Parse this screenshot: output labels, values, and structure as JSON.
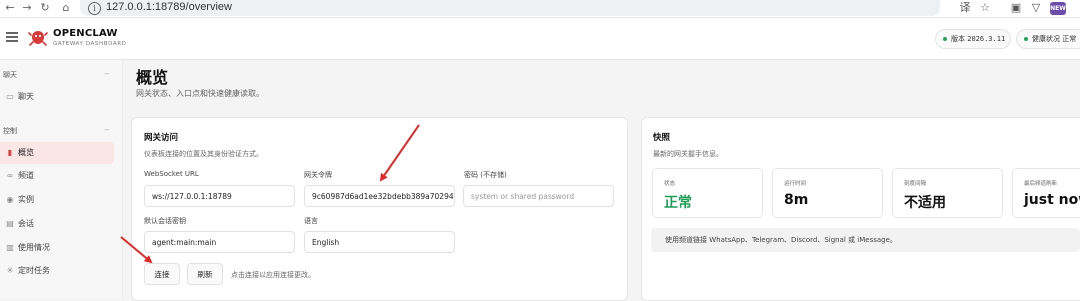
{
  "browser": {
    "back_glyph": "←",
    "forward_glyph": "→",
    "reload_glyph": "↻",
    "home_glyph": "⌂",
    "info_glyph": "i",
    "url": "127.0.0.1:18789/overview",
    "translate_glyph": "译",
    "star_glyph": "☆",
    "extension_glyph": "▣",
    "vpn_glyph": "▽",
    "new_badge": "NEW"
  },
  "header": {
    "brand_title": "OPENCLAW",
    "brand_subtitle": "GATEWAY DASHBOARD",
    "version_label": "版本",
    "version_value": "2026.3.11",
    "health_label": "健康状况",
    "health_value": "正常",
    "status_color": "#22a55a"
  },
  "sidebar": {
    "sections": [
      {
        "label": "聊天",
        "caret": "−",
        "items": [
          {
            "label": "聊天",
            "icon": "chat-icon",
            "glyph": "▭"
          }
        ]
      },
      {
        "label": "控制",
        "caret": "−",
        "items": [
          {
            "label": "概览",
            "icon": "bar-chart-icon",
            "glyph": "▮",
            "active": true
          },
          {
            "label": "频道",
            "icon": "link-icon",
            "glyph": "∞"
          },
          {
            "label": "实例",
            "icon": "radio-icon",
            "glyph": "◉"
          },
          {
            "label": "会话",
            "icon": "file-icon",
            "glyph": "▤"
          },
          {
            "label": "使用情况",
            "icon": "chart-icon",
            "glyph": "▥"
          },
          {
            "label": "定时任务",
            "icon": "loader-icon",
            "glyph": "✳"
          }
        ]
      }
    ],
    "accent_color": "#d64545"
  },
  "main": {
    "title": "概览",
    "subtitle": "网关状态、入口点和快速健康读取。",
    "gateway_card": {
      "title": "网关访问",
      "subtitle": "仪表板连接的位置及其身份验证方式。",
      "ws_label": "WebSocket URL",
      "ws_value": "ws://127.0.0.1:18789",
      "token_label": "网关令牌",
      "token_value": "9c60987d6ad1ee32bdebb389a70294",
      "password_label": "密码 (不存储)",
      "password_placeholder": "system or shared password",
      "session_label": "默认会话密钥",
      "session_value": "agent:main:main",
      "language_label": "语言",
      "language_value": "English",
      "connect_label": "连接",
      "refresh_label": "刷新",
      "hint": "点击连接以应用连接更改。"
    },
    "snapshot_card": {
      "title": "快照",
      "subtitle": "最新的网关握手信息。",
      "stats": [
        {
          "label": "状态",
          "value": "正常",
          "color": "#1e9e57"
        },
        {
          "label": "运行时间",
          "value": "8m"
        },
        {
          "label": "刻度间隔",
          "value": "不适用"
        },
        {
          "label": "最后频道刷新",
          "value": "just now"
        }
      ],
      "note": "使用频道链接 WhatsApp、Telegram、Discord、Signal 或 iMessage。"
    }
  },
  "annotation_color": "#e02828"
}
